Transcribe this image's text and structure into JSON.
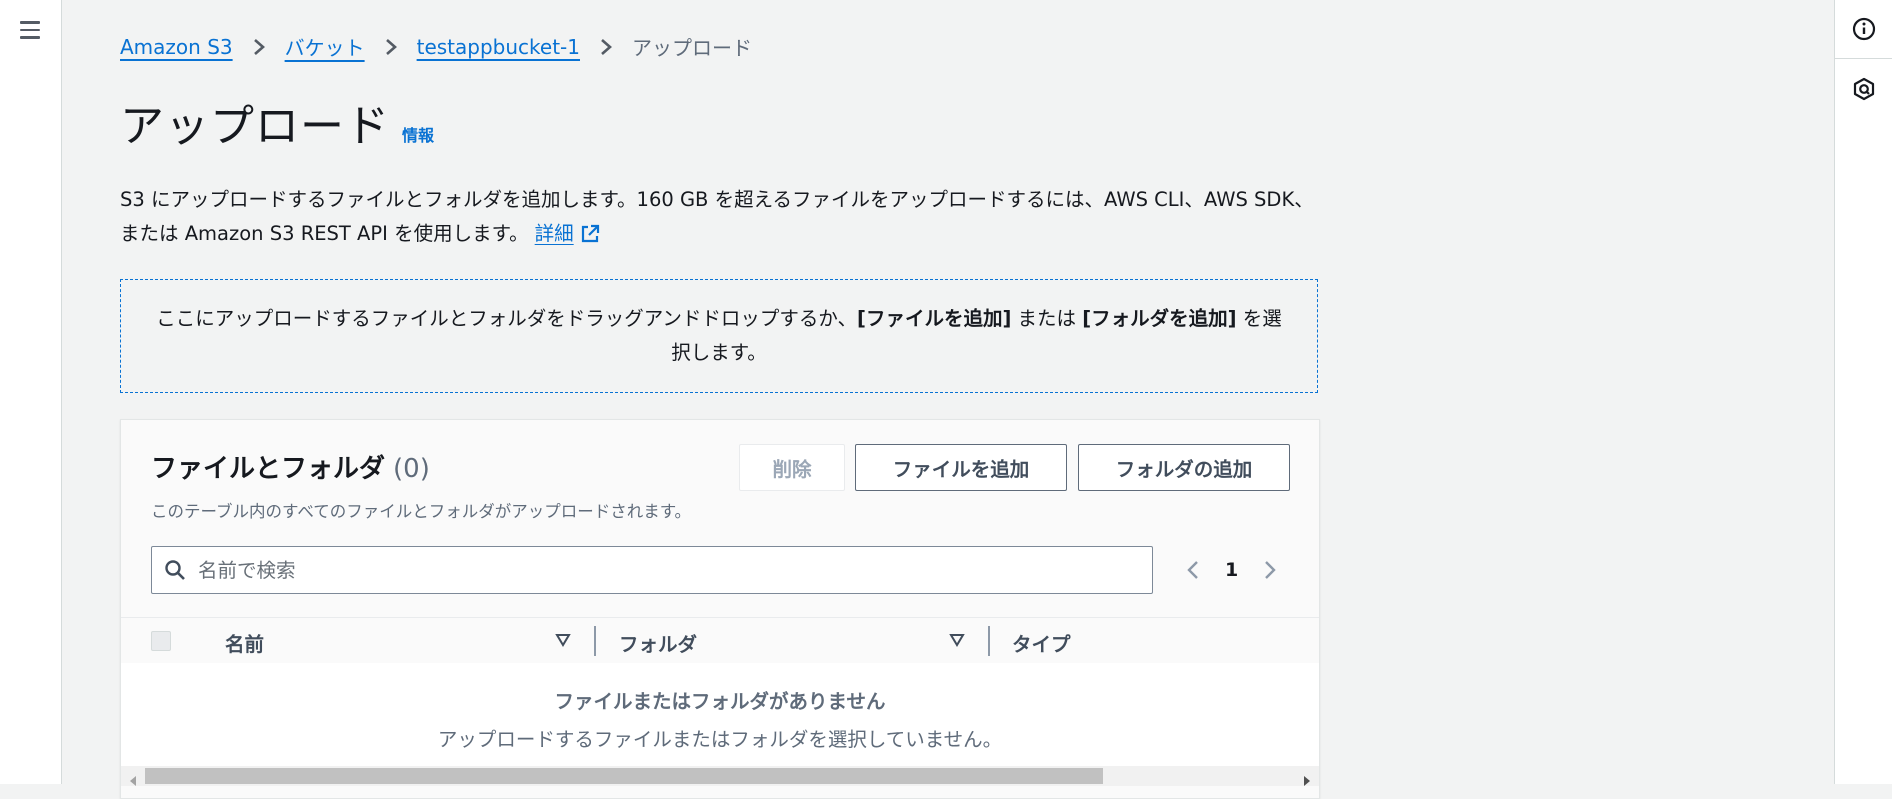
{
  "breadcrumbs": [
    {
      "label": "Amazon S3"
    },
    {
      "label": "バケット"
    },
    {
      "label": "testappbucket-1"
    }
  ],
  "breadcrumb_current": "アップロード",
  "page": {
    "title": "アップロード",
    "info_link": "情報",
    "description": "S3 にアップロードするファイルとフォルダを追加します。160 GB を超えるファイルをアップロードするには、AWS CLI、AWS SDK、または Amazon S3 REST API を使用します。",
    "learn_more": "詳細"
  },
  "dropzone": {
    "text_prefix": "ここにアップロードするファイルとフォルダをドラッグアンドドロップするか、",
    "add_files_bold": "[ファイルを追加]",
    "or": " または ",
    "add_folder_bold": "[フォルダを追加]",
    "text_suffix": " を選択します。"
  },
  "files_panel": {
    "title": "ファイルとフォルダ",
    "count": "(0)",
    "description": "このテーブル内のすべてのファイルとフォルダがアップロードされます。",
    "buttons": {
      "delete": "削除",
      "add_files": "ファイルを追加",
      "add_folder": "フォルダの追加"
    },
    "search_placeholder": "名前で検索",
    "pagination": {
      "current_page": "1"
    },
    "columns": [
      "名前",
      "フォルダ",
      "タイプ"
    ],
    "empty_title": "ファイルまたはフォルダがありません",
    "empty_subtitle": "アップロードするファイルまたはフォルダを選択していません。"
  },
  "colors": {
    "link": "#0972d3",
    "text": "#16191f",
    "muted": "#5f6b7a",
    "background": "#f2f3f3"
  },
  "icons": [
    "menu-icon",
    "info-icon",
    "help-panel-icon",
    "chevron-right-icon",
    "external-link-icon",
    "search-icon",
    "chevron-left-icon",
    "sort-down-icon"
  ]
}
